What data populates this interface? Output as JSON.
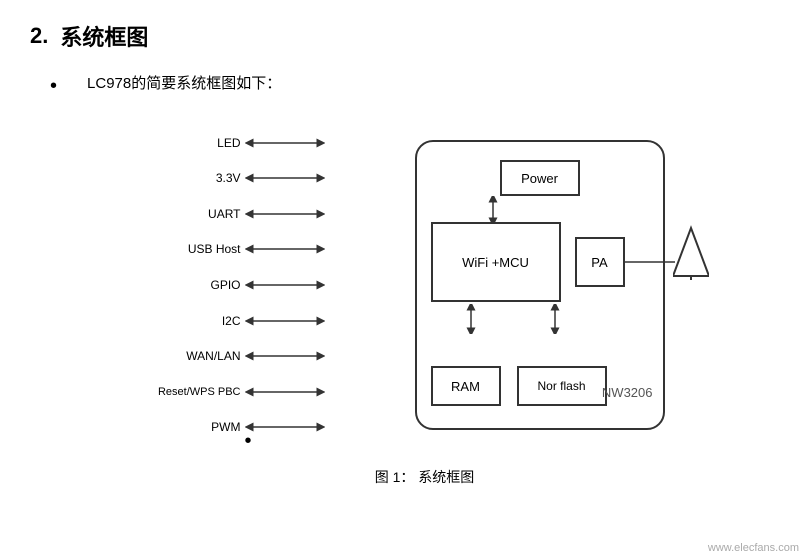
{
  "section": {
    "number": "2.",
    "title": "系统框图"
  },
  "bullet": {
    "dot": "•",
    "text": "LC978的简要系统框图如下："
  },
  "diagram": {
    "arrows": [
      {
        "label": "LED"
      },
      {
        "label": "3.3V"
      },
      {
        "label": "UART"
      },
      {
        "label": "USB Host"
      },
      {
        "label": "GPIO"
      },
      {
        "label": "I2C"
      },
      {
        "label": "WAN/LAN"
      },
      {
        "label": "Reset/WPS PBC"
      },
      {
        "label": "PWM"
      }
    ],
    "boxes": {
      "power": "Power",
      "wifi": "WiFi +MCU",
      "pa": "PA",
      "ram": "RAM",
      "norflash": "Nor flash",
      "chip_id": "NW3206"
    },
    "caption": "图 1：  系统框图"
  },
  "watermark": "www.elecfans.com"
}
